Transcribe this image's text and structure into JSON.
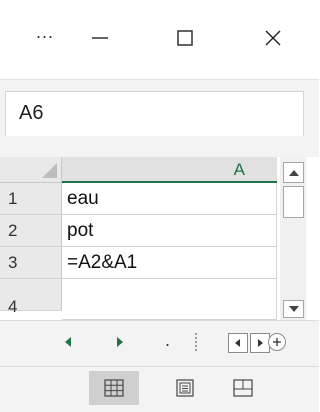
{
  "titlebar": {
    "ellipsis": "...",
    "icons": [
      "minimize-icon",
      "maximize-icon",
      "close-icon"
    ]
  },
  "namebox": {
    "value": "A6"
  },
  "grid": {
    "column_header": "A",
    "rows": [
      {
        "num": "1",
        "value": "eau"
      },
      {
        "num": "2",
        "value": "pot"
      },
      {
        "num": "3",
        "value": "=A2&A1"
      },
      {
        "num": "4",
        "value": ""
      }
    ]
  },
  "tabbar": {
    "dots": ".",
    "icons": [
      "scroll-prev-sheet-icon",
      "scroll-next-sheet-icon",
      "scroll-left-icon",
      "scroll-right-icon",
      "add-sheet-icon"
    ]
  },
  "viewbar": {
    "active_view": "normal",
    "icons": [
      "normal-view-icon",
      "page-layout-view-icon",
      "page-break-preview-icon"
    ]
  },
  "colors": {
    "accent": "#217346",
    "chrome": "#f3f3f3",
    "header": "#e9e9e9"
  }
}
